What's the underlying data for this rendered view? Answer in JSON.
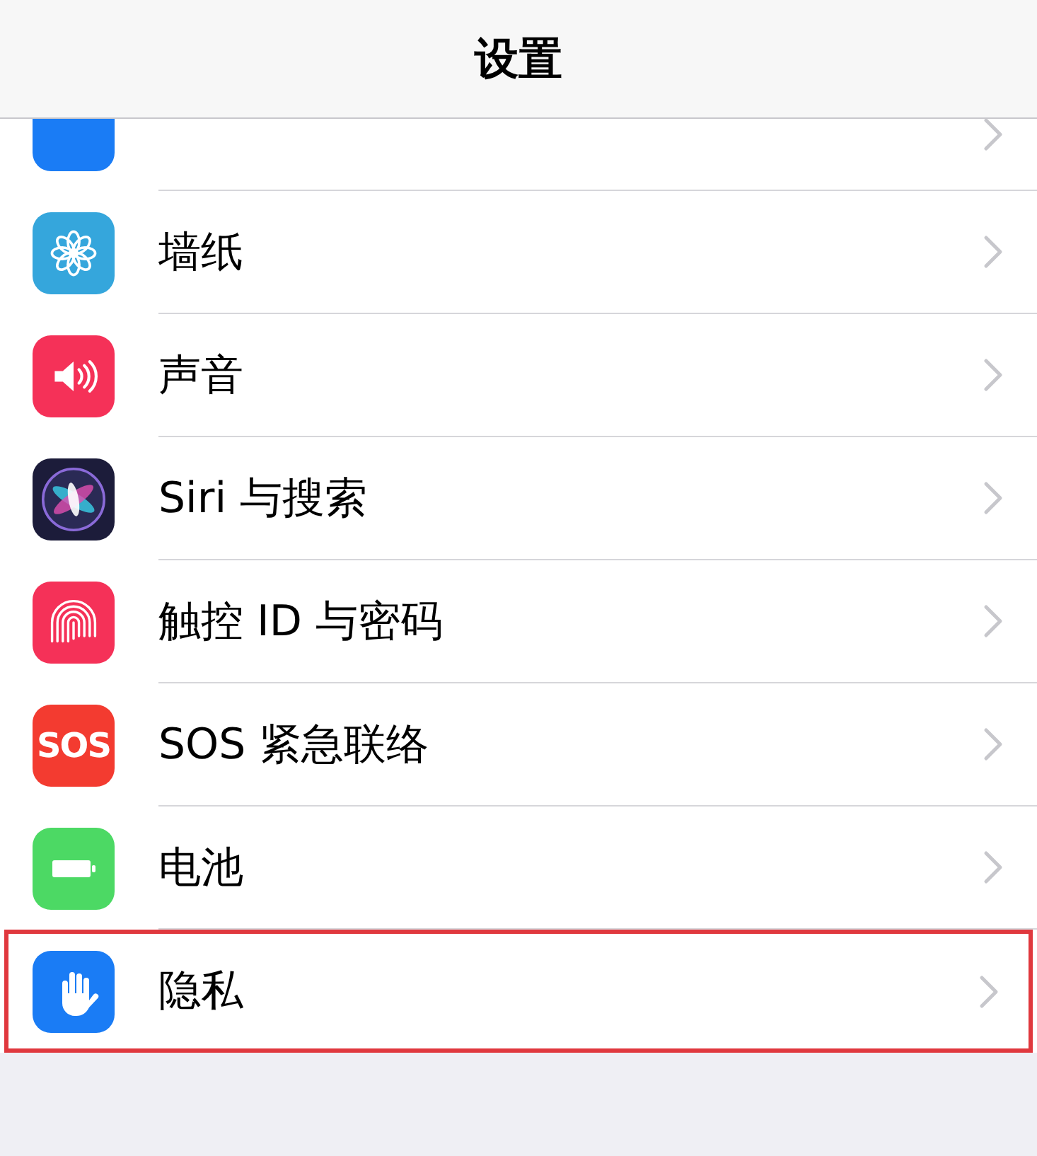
{
  "nav_bar": {
    "title": "设置"
  },
  "rows": [
    {
      "kind": "display",
      "color": "#1a7cf5",
      "highlighted": false
    },
    {
      "kind": "wallpaper",
      "color": "#35a6dc",
      "label": "墙纸",
      "highlighted": false
    },
    {
      "kind": "sound",
      "color": "#f53158",
      "label": "声音",
      "highlighted": false
    },
    {
      "kind": "siri",
      "color": "#1c1c3a",
      "label": "Siri 与搜索",
      "highlighted": false
    },
    {
      "kind": "touchid",
      "color": "#f53158",
      "label": "触控 ID 与密码",
      "highlighted": false
    },
    {
      "kind": "sos",
      "icon_text": "SOS",
      "color": "#f33b30",
      "label": "SOS 紧急联络",
      "highlighted": false
    },
    {
      "kind": "battery",
      "color": "#4cd964",
      "label": "电池",
      "highlighted": false
    },
    {
      "kind": "privacy",
      "color": "#1a7cf5",
      "label": "隐私",
      "highlighted": true
    }
  ]
}
